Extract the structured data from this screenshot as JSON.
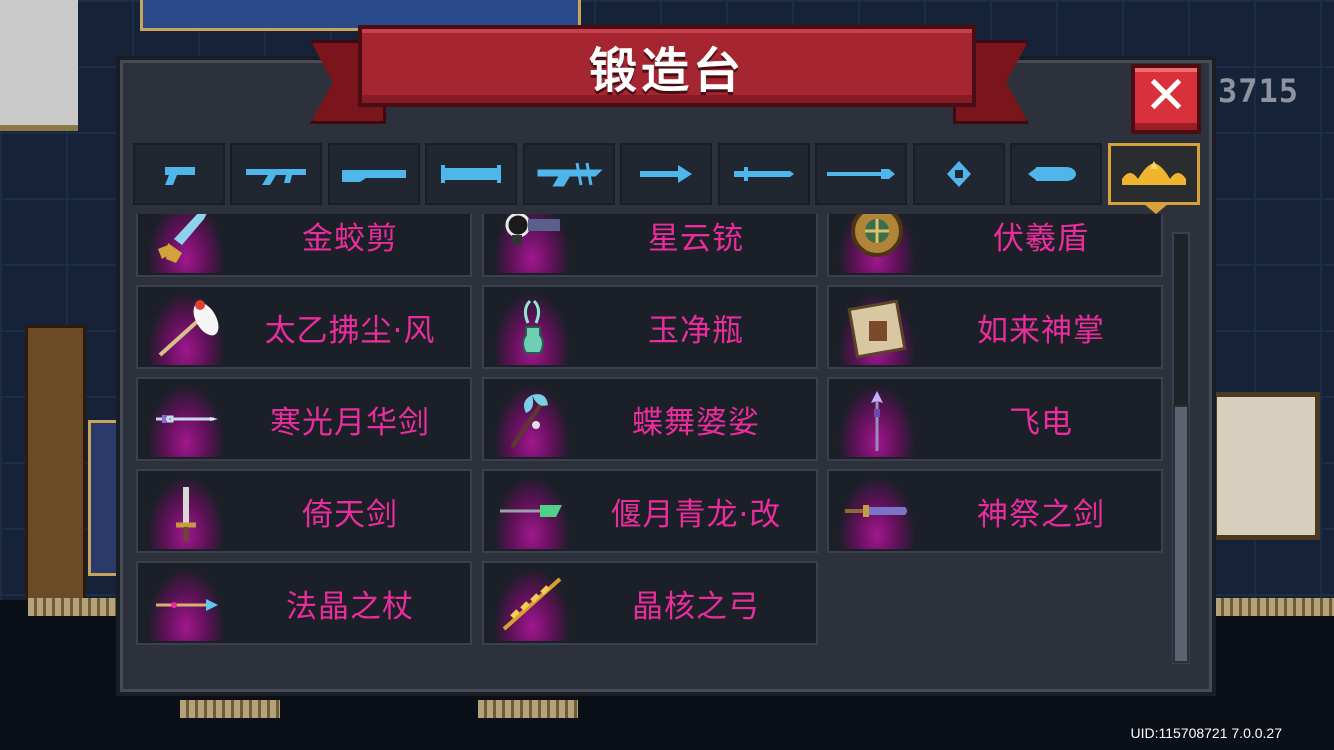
{
  "title": "锻造台",
  "close_label": "✕",
  "score": "3715",
  "uid_text": "UID:115708721 7.0.0.27",
  "colors": {
    "accent_gold": "#d9a13a",
    "name_pink": "#ea2d9c",
    "banner_red": "#a52631"
  },
  "tabs": [
    {
      "icon": "pistol-icon"
    },
    {
      "icon": "rifle-icon"
    },
    {
      "icon": "shotgun-icon"
    },
    {
      "icon": "launcher-icon"
    },
    {
      "icon": "crossbow-icon"
    },
    {
      "icon": "bow-icon"
    },
    {
      "icon": "melee-icon"
    },
    {
      "icon": "spear-icon"
    },
    {
      "icon": "staff-icon"
    },
    {
      "icon": "special-icon"
    },
    {
      "icon": "crown-icon",
      "active": true
    }
  ],
  "items": [
    {
      "name": "金蛟剪",
      "icon": "scissors-weapon-icon"
    },
    {
      "name": "星云铳",
      "icon": "nebula-gun-icon"
    },
    {
      "name": "伏羲盾",
      "icon": "fuxi-shield-icon"
    },
    {
      "name": "太乙拂尘·风",
      "icon": "whisk-icon"
    },
    {
      "name": "玉净瓶",
      "icon": "jade-vase-icon"
    },
    {
      "name": "如来神掌",
      "icon": "palm-scroll-icon"
    },
    {
      "name": "寒光月华剑",
      "icon": "moon-sword-icon"
    },
    {
      "name": "蝶舞婆娑",
      "icon": "butterfly-staff-icon"
    },
    {
      "name": "飞电",
      "icon": "lightning-spear-icon"
    },
    {
      "name": "倚天剑",
      "icon": "yitian-sword-icon"
    },
    {
      "name": "偃月青龙·改",
      "icon": "dragon-glaive-icon"
    },
    {
      "name": "神祭之剑",
      "icon": "ritual-sword-icon"
    },
    {
      "name": "法晶之杖",
      "icon": "crystal-staff-icon"
    },
    {
      "name": "晶核之弓",
      "icon": "crystal-bow-icon"
    }
  ]
}
